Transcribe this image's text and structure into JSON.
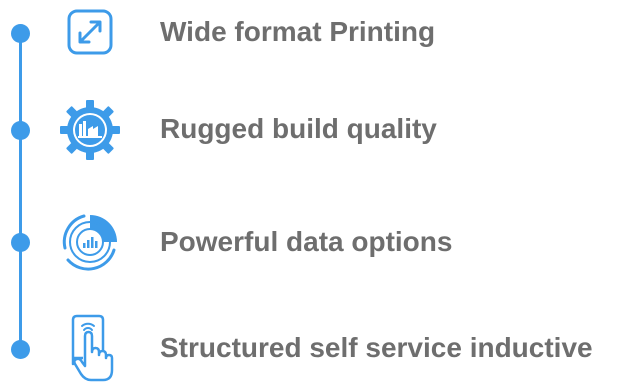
{
  "accent_color": "#3d9be9",
  "text_color": "#6e6e6e",
  "features": [
    {
      "icon": "expand-arrows-icon",
      "label": "Wide format Printing"
    },
    {
      "icon": "gear-factory-icon",
      "label": "Rugged build quality"
    },
    {
      "icon": "data-chart-icon",
      "label": "Powerful data options"
    },
    {
      "icon": "touch-hand-icon",
      "label": "Structured self service inductive"
    }
  ]
}
